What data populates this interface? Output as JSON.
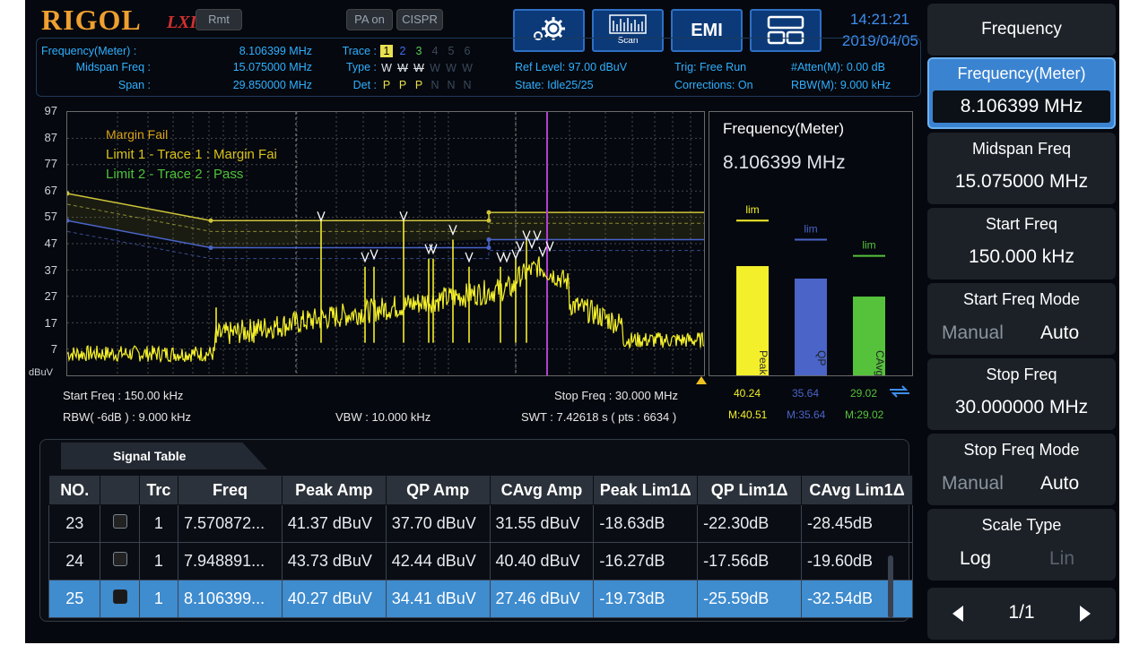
{
  "header": {
    "brand": "RIGOL",
    "lxi": "LXI",
    "rmt": "Rmt",
    "pa_on": "PA on",
    "cispr": "CISPR",
    "scan_label": "Scan",
    "emi_label": "EMI",
    "time": "14:21:21",
    "date": "2019/04/05"
  },
  "info": {
    "freq_meter_label": "Frequency(Meter) :",
    "freq_meter_value": "8.106399 MHz",
    "midspan_label": "Midspan Freq :",
    "midspan_value": "15.075000 MHz",
    "span_label": "Span :",
    "span_value": "29.850000 MHz",
    "trace_label": "Trace :",
    "trace_nums": [
      "1",
      "2",
      "3",
      "4",
      "5",
      "6"
    ],
    "type_label": "Type :",
    "type_vals": [
      "W",
      "W",
      "W",
      "W",
      "W",
      "W"
    ],
    "det_label": "Det :",
    "det_vals": [
      "P",
      "P",
      "P",
      "N",
      "N",
      "N"
    ],
    "ref_level": "Ref Level: 97.00 dBuV",
    "state": "State: Idle25/25",
    "trig": "Trig: Free Run",
    "corrections": "Corrections: On",
    "atten": "#Atten(M): 0.00 dB",
    "rbw_m": "RBW(M): 9.000 kHz"
  },
  "graph": {
    "y_ticks": [
      "97",
      "87",
      "77",
      "67",
      "57",
      "47",
      "37",
      "27",
      "17",
      "7"
    ],
    "y_unit": "dBuV",
    "margin_fail": "Margin Fail",
    "limit1": "Limit 1 - Trace 1 : Margin Fai",
    "limit2": "Limit 2 - Trace 2 : Pass",
    "start_freq": "Start Freq : 150.00 kHz",
    "stop_freq": "Stop Freq : 30.000 MHz",
    "rbw": "RBW( -6dB ) : 9.000 kHz",
    "vbw": "VBW : 10.000 kHz",
    "swt": "SWT : 7.42618 s ( pts : 6634 )"
  },
  "meter": {
    "title": "Frequency(Meter)",
    "value": "8.106399 MHz",
    "lim_label": "lim",
    "bars": [
      {
        "name": "Peak",
        "value": 40.24,
        "value_text": "40.24",
        "max_text": "M:40.51",
        "limit": 57,
        "color": "#f3ef2a"
      },
      {
        "name": "QP",
        "value": 35.64,
        "value_text": "35.64",
        "max_text": "M:35.64",
        "limit": 50,
        "color": "#4a64c8"
      },
      {
        "name": "CAvg",
        "value": 29.02,
        "value_text": "29.02",
        "max_text": "M:29.02",
        "limit": 44,
        "color": "#56c23c"
      }
    ]
  },
  "signal_table": {
    "title": "Signal Table",
    "columns": [
      "NO.",
      "",
      "Trc",
      "Freq",
      "Peak Amp",
      "QP Amp",
      "CAvg Amp",
      "Peak Lim1Δ",
      "QP Lim1Δ",
      "CAvg Lim1Δ"
    ],
    "rows": [
      {
        "no": "23",
        "trc": "1",
        "freq": "7.570872...",
        "peak": "41.37 dBuV",
        "qp": "37.70 dBuV",
        "cavg": "31.55 dBuV",
        "peak_lim": "-18.63dB",
        "qp_lim": "-22.30dB",
        "cavg_lim": "-28.45dB"
      },
      {
        "no": "24",
        "trc": "1",
        "freq": "7.948891...",
        "peak": "43.73 dBuV",
        "qp": "42.44 dBuV",
        "cavg": "40.40 dBuV",
        "peak_lim": "-16.27dB",
        "qp_lim": "-17.56dB",
        "cavg_lim": "-19.60dB"
      },
      {
        "no": "25",
        "trc": "1",
        "freq": "8.106399...",
        "peak": "40.27 dBuV",
        "qp": "34.41 dBuV",
        "cavg": "27.46 dBuV",
        "peak_lim": "-19.73dB",
        "qp_lim": "-25.59dB",
        "cavg_lim": "-32.54dB"
      }
    ],
    "selected_row": 2
  },
  "menu": {
    "title": "Frequency",
    "freq_meter_label": "Frequency(Meter)",
    "freq_meter_value": "8.106399 MHz",
    "midspan_label": "Midspan Freq",
    "midspan_value": "15.075000 MHz",
    "start_label": "Start Freq",
    "start_value": "150.000 kHz",
    "start_mode_label": "Start Freq Mode",
    "stop_label": "Stop Freq",
    "stop_value": "30.000000 MHz",
    "stop_mode_label": "Stop Freq Mode",
    "manual": "Manual",
    "auto": "Auto",
    "scale_label": "Scale Type",
    "log": "Log",
    "lin": "Lin",
    "page": "1/1"
  }
}
